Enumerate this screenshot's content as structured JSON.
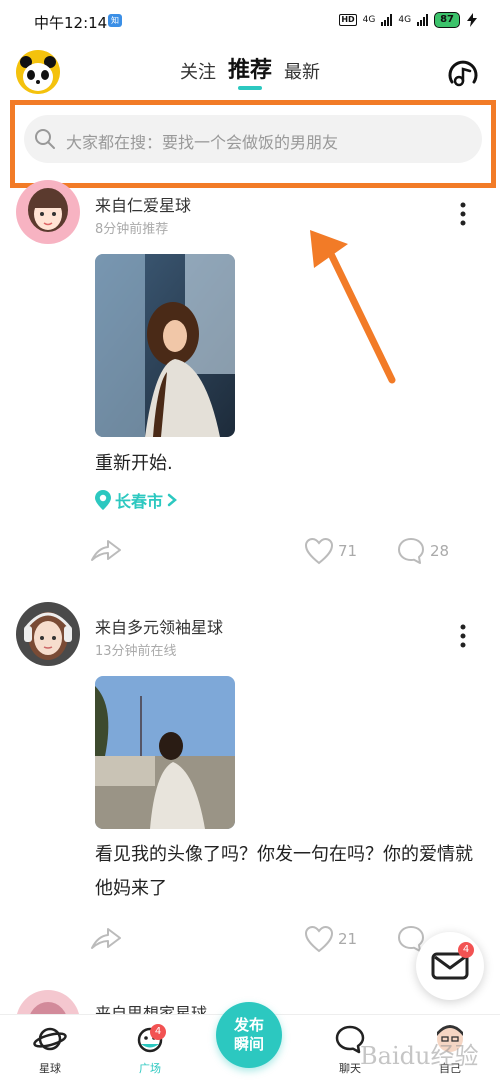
{
  "status_bar": {
    "time": "中午12:14",
    "app_notice": "知",
    "network_1": "4G",
    "network_2": "4G",
    "battery": "87",
    "hd": "HD"
  },
  "header": {
    "tabs": [
      "关注",
      "推荐",
      "最新"
    ],
    "active_tab": 1
  },
  "search": {
    "placeholder": "大家都在搜：要找一个会做饭的男朋友"
  },
  "posts": [
    {
      "source": "来自仁爱星球",
      "time": "8分钟前推荐",
      "text": "重新开始.",
      "location": "长春市",
      "likes": "71",
      "comments": "28"
    },
    {
      "source": "来自多元领袖星球",
      "time": "13分钟前在线",
      "text_line1": "看见我的头像了吗？你发一句在吗？你的爱情就",
      "text_line2": "他妈来了",
      "likes": "21"
    },
    {
      "source": "来自思想家星球"
    }
  ],
  "message_fab": {
    "badge": "4"
  },
  "bottom_nav": {
    "items": [
      "星球",
      "广场",
      "聊天",
      "自己"
    ],
    "guangchang_badge": "4",
    "publish_line1": "发布",
    "publish_line2": "瞬间"
  },
  "watermark": "Baidu经验",
  "colors": {
    "accent": "#2cc8c0",
    "highlight": "#f27b27",
    "badge": "#f25252"
  }
}
